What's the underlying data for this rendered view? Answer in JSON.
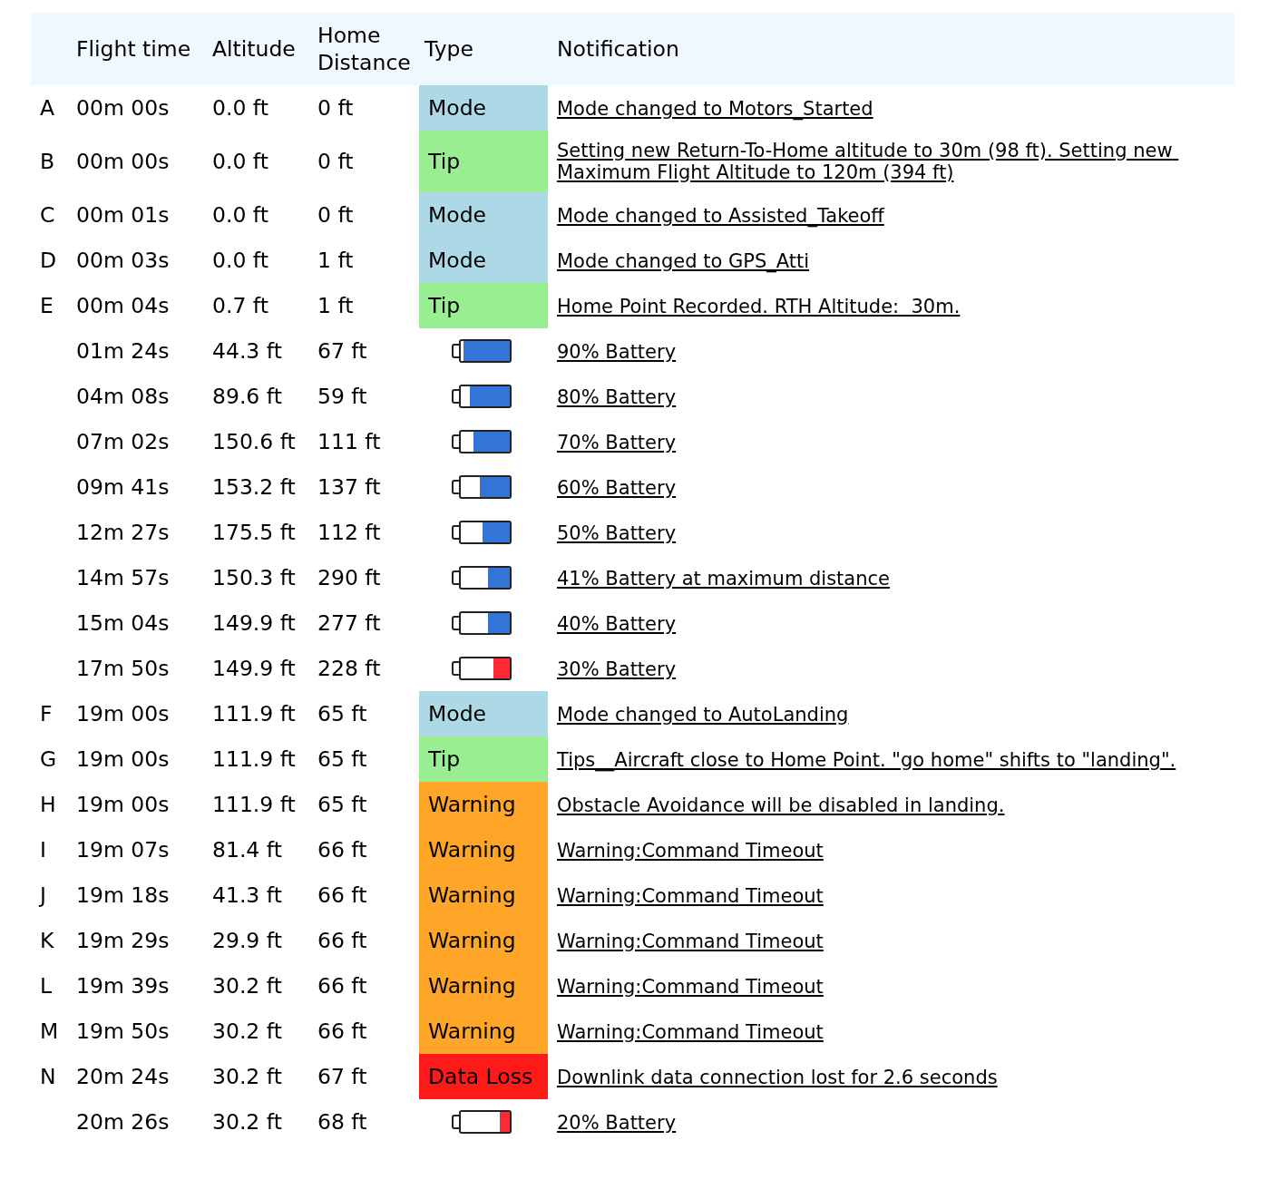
{
  "columns": [
    "Flight time",
    "Altitude",
    "Home Distance",
    "Type",
    "Notification"
  ],
  "rows": [
    {
      "marker": "A",
      "flight_time": "00m 00s",
      "altitude": "0.0 ft",
      "home_distance": "0 ft",
      "type": {
        "kind": "mode",
        "label": "Mode"
      },
      "notification": "Mode changed to Motors_Started"
    },
    {
      "marker": "B",
      "flight_time": "00m 00s",
      "altitude": "0.0 ft",
      "home_distance": "0 ft",
      "type": {
        "kind": "tip",
        "label": "Tip"
      },
      "notification": "Setting new Return-To-Home altitude to 30m (98 ft). Setting new Maximum Flight Altitude to 120m (394 ft)"
    },
    {
      "marker": "C",
      "flight_time": "00m 01s",
      "altitude": "0.0 ft",
      "home_distance": "0 ft",
      "type": {
        "kind": "mode",
        "label": "Mode"
      },
      "notification": "Mode changed to Assisted_Takeoff"
    },
    {
      "marker": "D",
      "flight_time": "00m 03s",
      "altitude": "0.0 ft",
      "home_distance": "1 ft",
      "type": {
        "kind": "mode",
        "label": "Mode"
      },
      "notification": "Mode changed to GPS_Atti"
    },
    {
      "marker": "E",
      "flight_time": "00m 04s",
      "altitude": "0.7 ft",
      "home_distance": "1 ft",
      "type": {
        "kind": "tip",
        "label": "Tip"
      },
      "notification": "Home Point Recorded. RTH Altitude:  30m."
    },
    {
      "flight_time": "01m 24s",
      "altitude": "44.3 ft",
      "home_distance": "67 ft",
      "type": {
        "kind": "battery",
        "level": 0.95,
        "color": "#3375d6"
      },
      "notification": "90% Battery"
    },
    {
      "flight_time": "04m 08s",
      "altitude": "89.6 ft",
      "home_distance": "59 ft",
      "type": {
        "kind": "battery",
        "level": 0.82,
        "color": "#3375d6"
      },
      "notification": "80% Battery"
    },
    {
      "flight_time": "07m 02s",
      "altitude": "150.6 ft",
      "home_distance": "111 ft",
      "type": {
        "kind": "battery",
        "level": 0.75,
        "color": "#3375d6"
      },
      "notification": "70% Battery"
    },
    {
      "flight_time": "09m 41s",
      "altitude": "153.2 ft",
      "home_distance": "137 ft",
      "type": {
        "kind": "battery",
        "level": 0.62,
        "color": "#3375d6"
      },
      "notification": "60% Battery"
    },
    {
      "flight_time": "12m 27s",
      "altitude": "175.5 ft",
      "home_distance": "112 ft",
      "type": {
        "kind": "battery",
        "level": 0.55,
        "color": "#3375d6"
      },
      "notification": "50% Battery"
    },
    {
      "flight_time": "14m 57s",
      "altitude": "150.3 ft",
      "home_distance": "290 ft",
      "type": {
        "kind": "battery",
        "level": 0.44,
        "color": "#3375d6"
      },
      "notification": "41% Battery at maximum distance"
    },
    {
      "flight_time": "15m 04s",
      "altitude": "149.9 ft",
      "home_distance": "277 ft",
      "type": {
        "kind": "battery",
        "level": 0.44,
        "color": "#3375d6"
      },
      "notification": "40% Battery"
    },
    {
      "flight_time": "17m 50s",
      "altitude": "149.9 ft",
      "home_distance": "228 ft",
      "type": {
        "kind": "battery",
        "level": 0.33,
        "color": "#ff2a33"
      },
      "notification": "30% Battery"
    },
    {
      "marker": "F",
      "flight_time": "19m 00s",
      "altitude": "111.9 ft",
      "home_distance": "65 ft",
      "type": {
        "kind": "mode",
        "label": "Mode"
      },
      "notification": "Mode changed to AutoLanding"
    },
    {
      "marker": "G",
      "flight_time": "19m 00s",
      "altitude": "111.9 ft",
      "home_distance": "65 ft",
      "type": {
        "kind": "tip",
        "label": "Tip"
      },
      "notification": "Tips__Aircraft close to Home Point. \"go home\" shifts to \"landing\"."
    },
    {
      "marker": "H",
      "flight_time": "19m 00s",
      "altitude": "111.9 ft",
      "home_distance": "65 ft",
      "type": {
        "kind": "warning",
        "label": "Warning"
      },
      "notification": "Obstacle Avoidance will be disabled in landing."
    },
    {
      "marker": "I",
      "flight_time": "19m 07s",
      "altitude": "81.4 ft",
      "home_distance": "66 ft",
      "type": {
        "kind": "warning",
        "label": "Warning"
      },
      "notification": "Warning:Command Timeout"
    },
    {
      "marker": "J",
      "flight_time": "19m 18s",
      "altitude": "41.3 ft",
      "home_distance": "66 ft",
      "type": {
        "kind": "warning",
        "label": "Warning"
      },
      "notification": "Warning:Command Timeout"
    },
    {
      "marker": "K",
      "flight_time": "19m 29s",
      "altitude": "29.9 ft",
      "home_distance": "66 ft",
      "type": {
        "kind": "warning",
        "label": "Warning"
      },
      "notification": "Warning:Command Timeout"
    },
    {
      "marker": "L",
      "flight_time": "19m 39s",
      "altitude": "30.2 ft",
      "home_distance": "66 ft",
      "type": {
        "kind": "warning",
        "label": "Warning"
      },
      "notification": "Warning:Command Timeout"
    },
    {
      "marker": "M",
      "flight_time": "19m 50s",
      "altitude": "30.2 ft",
      "home_distance": "66 ft",
      "type": {
        "kind": "warning",
        "label": "Warning"
      },
      "notification": "Warning:Command Timeout"
    },
    {
      "marker": "N",
      "flight_time": "20m 24s",
      "altitude": "30.2 ft",
      "home_distance": "67 ft",
      "type": {
        "kind": "dataloss",
        "label": "Data Loss"
      },
      "notification": "Downlink data connection lost for 2.6 seconds"
    },
    {
      "flight_time": "20m 26s",
      "altitude": "30.2 ft",
      "home_distance": "68 ft",
      "type": {
        "kind": "battery",
        "level": 0.2,
        "color": "#ff2a33"
      },
      "notification": "20% Battery"
    }
  ]
}
